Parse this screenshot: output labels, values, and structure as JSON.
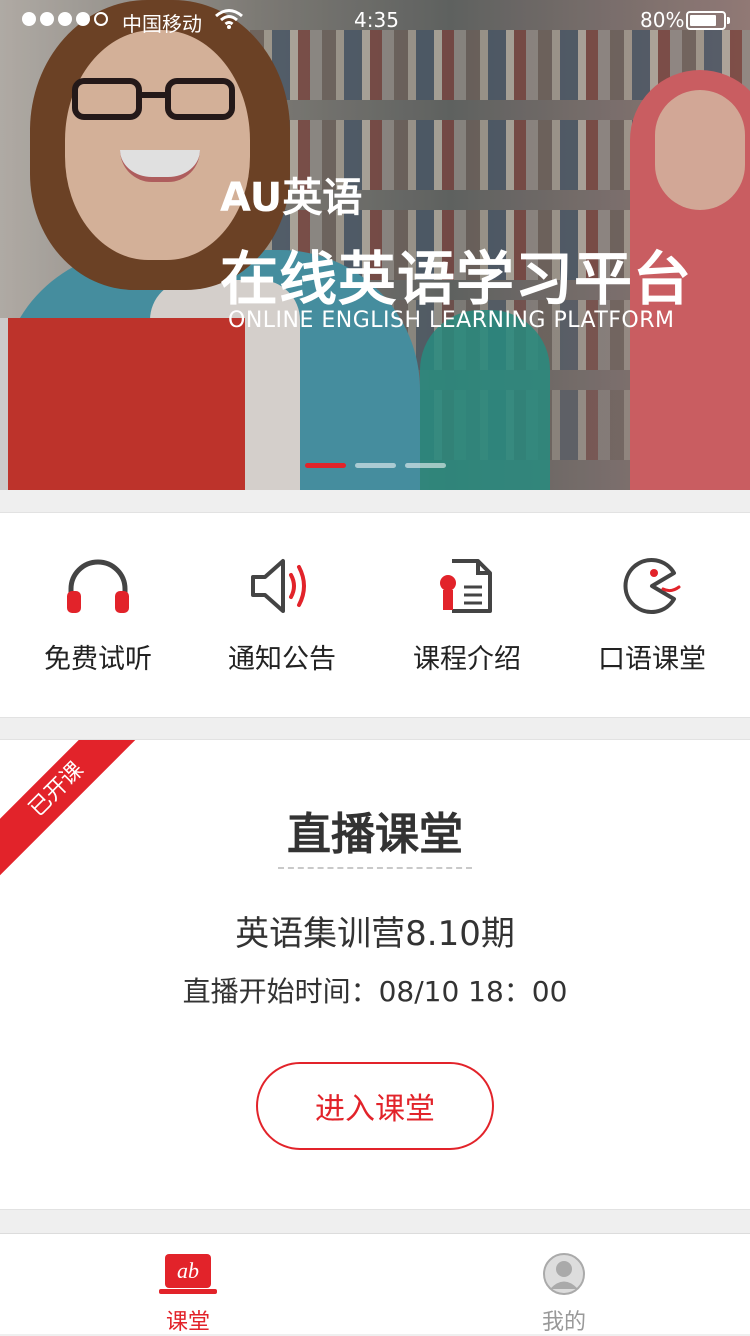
{
  "status_bar": {
    "carrier": "中国移动",
    "time": "4:35",
    "battery": "80%",
    "battery_level": 0.8
  },
  "banner": {
    "brand": "AU英语",
    "title": "在线英语学习平台",
    "subtitle": "ONLINE ENGLISH LEARNING PLATFORM",
    "slide_count": 3,
    "active_slide": 1
  },
  "quick_menu": [
    {
      "label": "免费试听",
      "icon": "headphones-icon"
    },
    {
      "label": "通知公告",
      "icon": "speaker-icon"
    },
    {
      "label": "课程介绍",
      "icon": "document-award-icon"
    },
    {
      "label": "口语课堂",
      "icon": "mouth-icon"
    }
  ],
  "live_class": {
    "badge": "已开课",
    "title": "直播课堂",
    "course_name": "英语集训营8.10期",
    "start_time": "直播开始时间：08/10   18：00",
    "button": "进入课堂"
  },
  "tab_bar": {
    "items": [
      {
        "label": "课堂",
        "icon": "classroom-icon",
        "active": true
      },
      {
        "label": "我的",
        "icon": "profile-icon",
        "active": false
      }
    ]
  },
  "colors": {
    "accent": "#e2232a",
    "text": "#333333",
    "muted": "#999999"
  }
}
